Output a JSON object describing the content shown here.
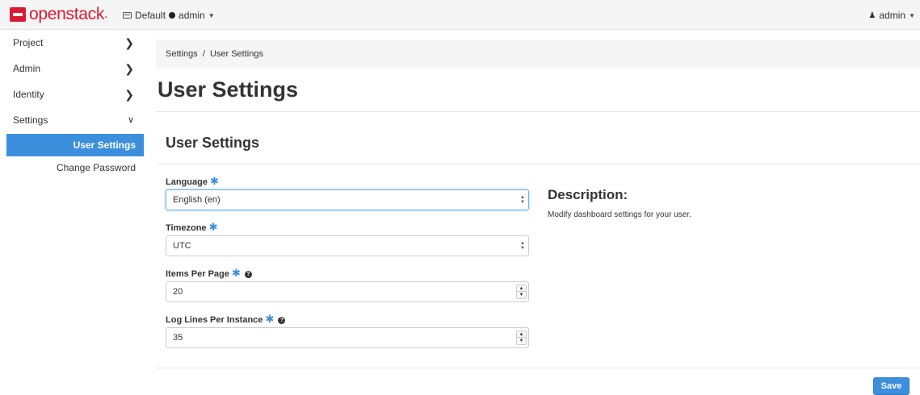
{
  "topbar": {
    "brand": "openstack",
    "domain": "Default",
    "project": "admin",
    "user": "admin"
  },
  "sidebar": {
    "items": [
      {
        "label": "Project",
        "chevron": "chevron-right-icon"
      },
      {
        "label": "Admin",
        "chevron": "chevron-right-icon"
      },
      {
        "label": "Identity",
        "chevron": "chevron-right-icon"
      },
      {
        "label": "Settings",
        "chevron": "chevron-down-icon"
      }
    ],
    "subitems": [
      {
        "label": "User Settings",
        "active": true
      },
      {
        "label": "Change Password",
        "active": false
      }
    ]
  },
  "breadcrumb": {
    "root": "Settings",
    "separator": "/",
    "current": "User Settings"
  },
  "page": {
    "title": "User Settings"
  },
  "form": {
    "section_title": "User Settings",
    "required_marker": "✱",
    "fields": [
      {
        "label": "Language",
        "value": "English (en)",
        "type": "select",
        "help": false
      },
      {
        "label": "Timezone",
        "value": "UTC",
        "type": "select",
        "help": false
      },
      {
        "label": "Items Per Page",
        "value": "20",
        "type": "number",
        "help": true
      },
      {
        "label": "Log Lines Per Instance",
        "value": "35",
        "type": "number",
        "help": true
      }
    ],
    "save_label": "Save"
  },
  "description": {
    "title": "Description:",
    "text": "Modify dashboard settings for your user."
  },
  "colors": {
    "brand_red": "#da1a32",
    "accent_blue": "#3b8fdc"
  }
}
